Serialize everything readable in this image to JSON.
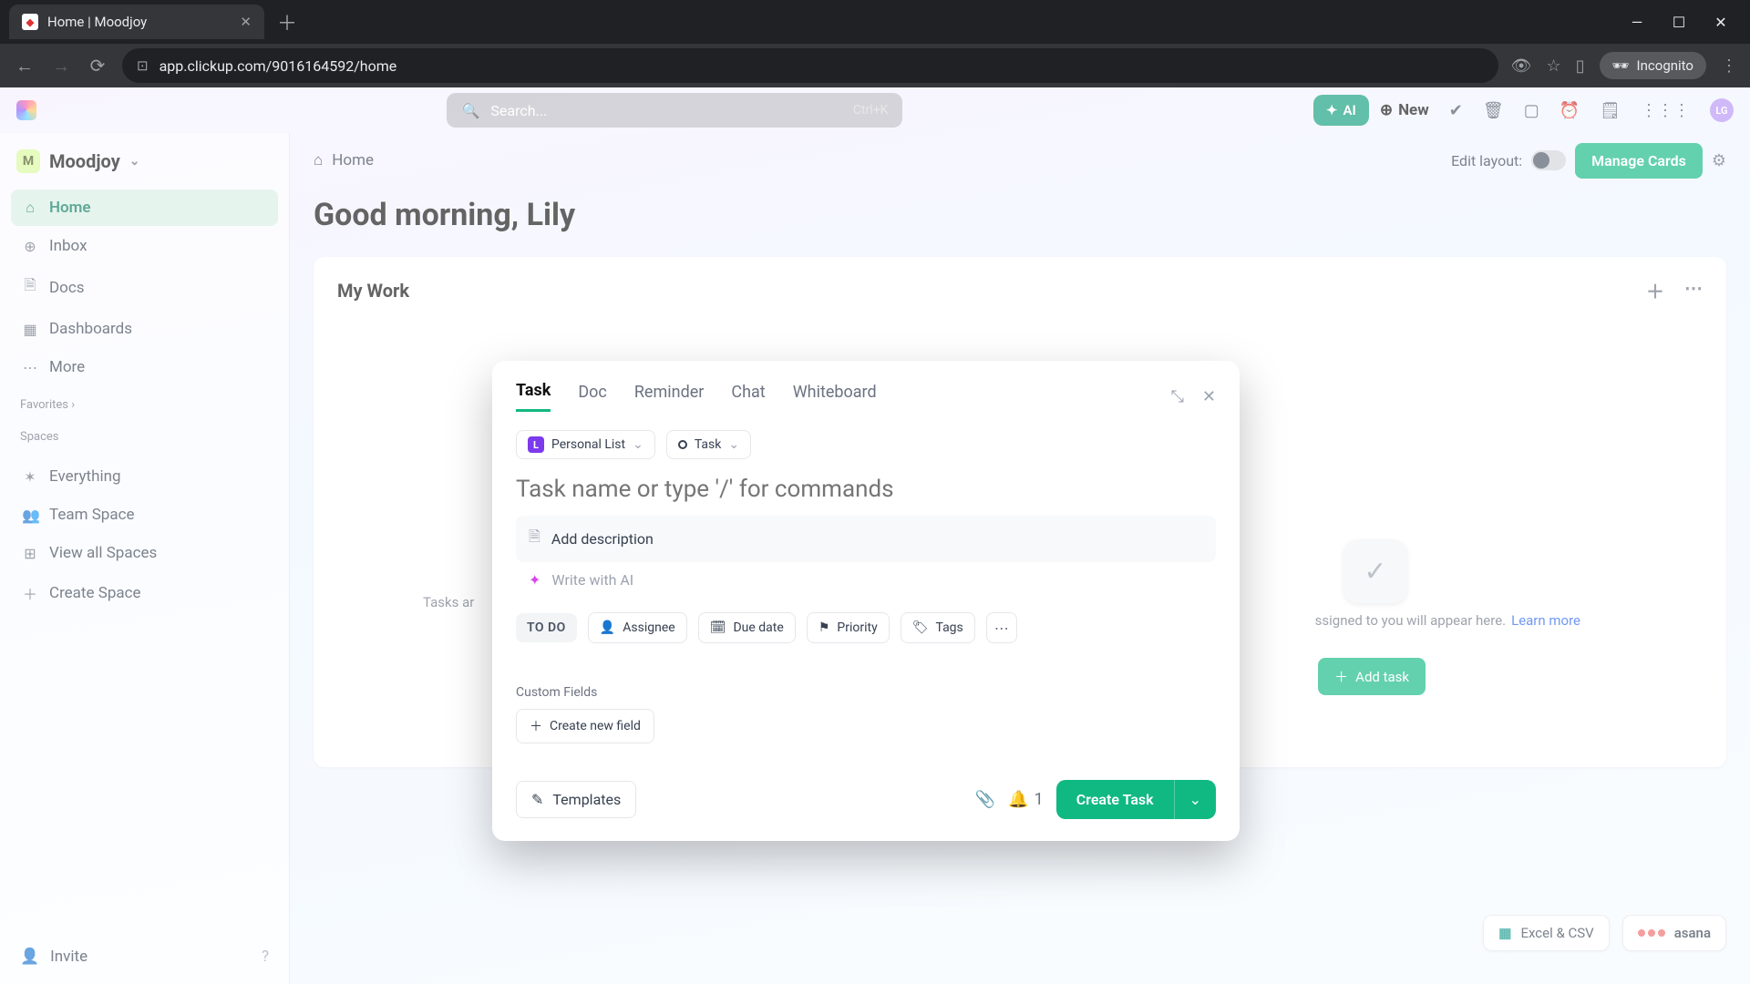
{
  "browser": {
    "tab_title": "Home | Moodjoy",
    "url": "app.clickup.com/9016164592/home",
    "incognito": "Incognito"
  },
  "topbar": {
    "search_placeholder": "Search...",
    "search_shortcut": "Ctrl+K",
    "ai_label": "AI",
    "new_label": "New",
    "avatar_initials": "LG"
  },
  "sidebar": {
    "workspace": "Moodjoy",
    "workspace_initial": "M",
    "nav": [
      {
        "icon": "⌂",
        "label": "Home",
        "active": true
      },
      {
        "icon": "⊕",
        "label": "Inbox"
      },
      {
        "icon": "🗎",
        "label": "Docs"
      },
      {
        "icon": "▦",
        "label": "Dashboards"
      },
      {
        "icon": "⋯",
        "label": "More"
      }
    ],
    "favorites_label": "Favorites",
    "spaces_label": "Spaces",
    "spaces": [
      {
        "icon": "✶",
        "label": "Everything"
      },
      {
        "icon": "👥",
        "label": "Team Space"
      },
      {
        "icon": "⊞",
        "label": "View all Spaces"
      },
      {
        "icon": "＋",
        "label": "Create Space"
      }
    ],
    "invite": "Invite"
  },
  "main": {
    "breadcrumb": "Home",
    "edit_layout": "Edit layout:",
    "manage_cards": "Manage Cards",
    "greeting": "Good morning, Lily",
    "panel_title": "My Work",
    "empty_left": "Tasks ar",
    "empty_right_suffix": "ssigned to you will appear here.",
    "learn_more": "Learn more",
    "add_task": "Add task",
    "excel_csv": "Excel & CSV",
    "asana": "asana"
  },
  "modal": {
    "tabs": [
      "Task",
      "Doc",
      "Reminder",
      "Chat",
      "Whiteboard"
    ],
    "active_tab": 0,
    "list_select": "Personal List",
    "type_select": "Task",
    "name_placeholder": "Task name or type '/' for commands",
    "desc_label": "Add description",
    "ai_write": "Write with AI",
    "status": "TO DO",
    "props": [
      "Assignee",
      "Due date",
      "Priority",
      "Tags"
    ],
    "custom_fields_label": "Custom Fields",
    "create_field": "Create new field",
    "templates": "Templates",
    "notif_count": "1",
    "create": "Create Task"
  }
}
